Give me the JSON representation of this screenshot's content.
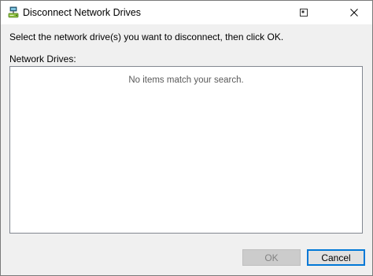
{
  "window": {
    "title": "Disconnect Network Drives",
    "icon": "network-drive-icon",
    "controls": {
      "help_icon": "help-window-icon",
      "close_icon": "close-icon"
    }
  },
  "instructions": "Select the network drive(s) you want to disconnect, then click OK.",
  "drive_list": {
    "label": "Network Drives:",
    "empty_message": "No items match your search.",
    "items": []
  },
  "buttons": {
    "ok_label": "OK",
    "ok_enabled": false,
    "cancel_label": "Cancel"
  },
  "colors": {
    "focus_border": "#0078d7",
    "dialog_background": "#f0f0f0"
  }
}
